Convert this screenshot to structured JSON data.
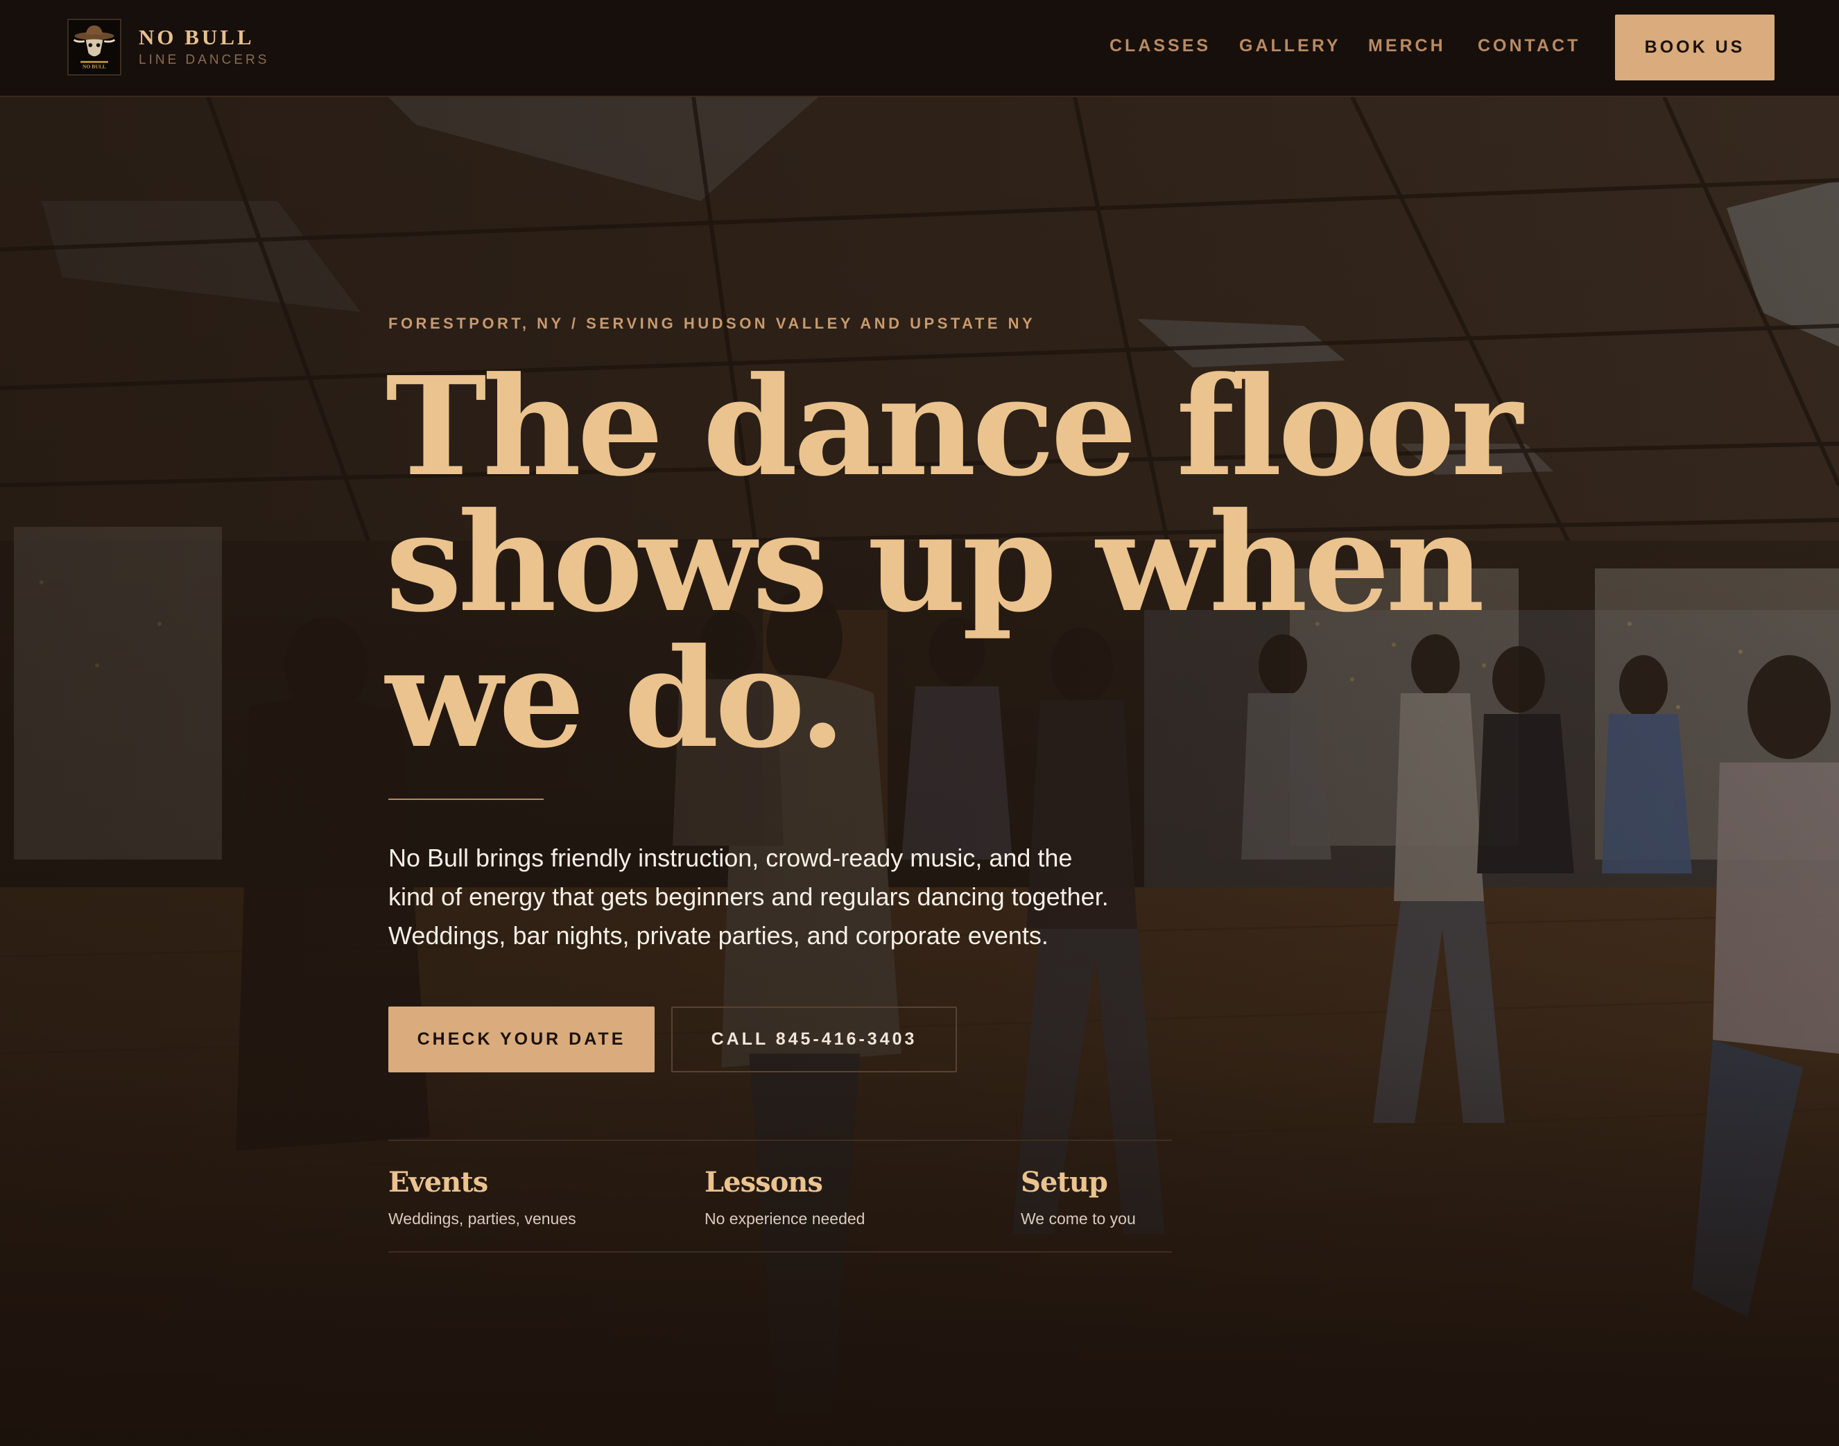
{
  "brand": {
    "name": "NO BULL",
    "tagline": "LINE DANCERS",
    "logo_icon": "bull-skull-cowboy-hat-icon",
    "logo_text": "NO BULL"
  },
  "nav": {
    "links": [
      "CLASSES",
      "GALLERY",
      "MERCH",
      "CONTACT"
    ],
    "cta": "BOOK US"
  },
  "hero": {
    "eyebrow": "FORESTPORT, NY / SERVING HUDSON VALLEY AND UPSTATE NY",
    "headline_lines": [
      "The dance floor",
      "shows up when",
      "we do."
    ],
    "intro_lines": [
      "No Bull brings friendly instruction, crowd-ready music, and the",
      "kind of energy that gets beginners and regulars dancing together.",
      "Weddings, bar nights, private parties, and corporate events."
    ],
    "primary_cta": "CHECK YOUR DATE",
    "secondary_cta": "CALL 845-416-3403",
    "background": "line-dance-class-photo"
  },
  "stats": [
    {
      "title": "Events",
      "subtitle": "Weddings, parties, venues"
    },
    {
      "title": "Lessons",
      "subtitle": "No experience needed"
    },
    {
      "title": "Setup",
      "subtitle": "We come to you"
    }
  ],
  "colors": {
    "accent": "#d9ab7d",
    "headline": "#ebc38e",
    "header_bg": "#170f0b",
    "page_bg": "#1c120c"
  }
}
